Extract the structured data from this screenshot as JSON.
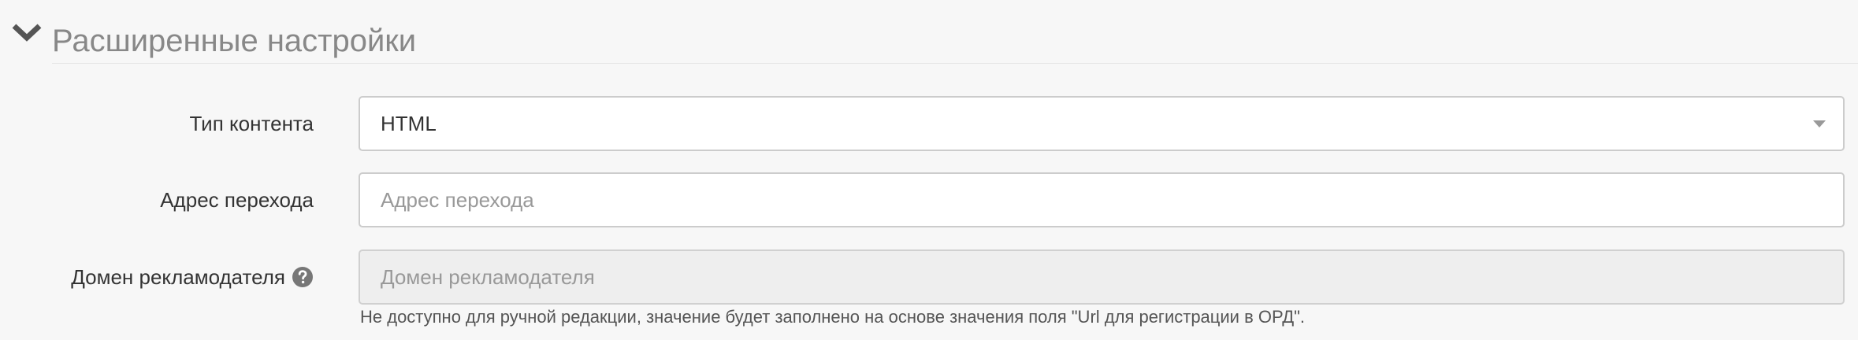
{
  "section": {
    "title": "Расширенные настройки",
    "collapse_icon": "chevron-down-icon"
  },
  "fields": {
    "content_type": {
      "label": "Тип контента",
      "value": "HTML",
      "control": "select"
    },
    "target_url": {
      "label": "Адрес перехода",
      "value": "",
      "placeholder": "Адрес перехода",
      "control": "text-input"
    },
    "advertiser_domain": {
      "label": "Домен рекламодателя",
      "value": "",
      "placeholder": "Домен рекламодателя",
      "help_icon": "question-circle-icon",
      "control": "text-input",
      "disabled": true,
      "help_text": "Не доступно для ручной редакции, значение будет заполнено на основе значения поля \"Url для регистрации в ОРД\"."
    }
  },
  "colors": {
    "background": "#f7f7f7",
    "section_title": "#888888",
    "input_border": "#cccccc",
    "disabled_input": "#eeeeee",
    "placeholder": "#999999"
  }
}
